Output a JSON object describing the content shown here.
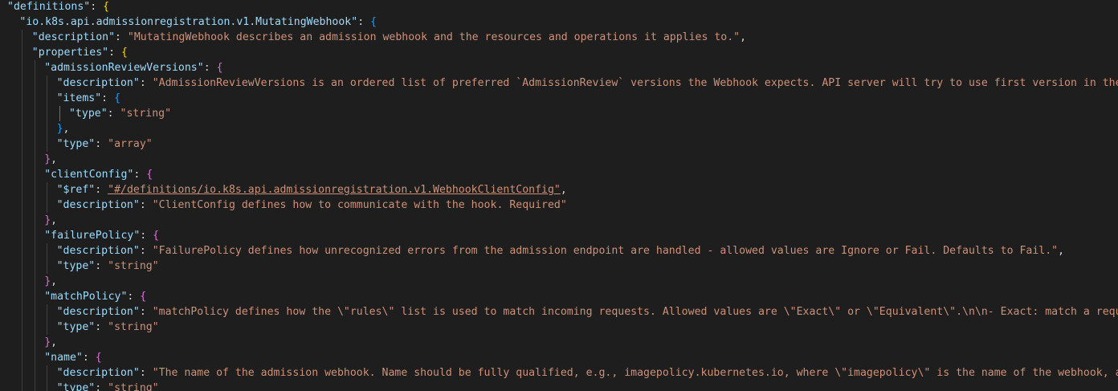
{
  "editor": {
    "lines": [
      {
        "indent": 0,
        "key": "\"definitions\"",
        "value": "",
        "open": "{",
        "bracket": "b1"
      },
      {
        "indent": 1,
        "key": "\"io.k8s.api.admissionregistration.v1.MutatingWebhook\"",
        "value": "",
        "open": "{",
        "bracket": "b3"
      },
      {
        "indent": 2,
        "key": "\"description\"",
        "value": "\"MutatingWebhook describes an admission webhook and the resources and operations it applies to.\"",
        "tail": ","
      },
      {
        "indent": 2,
        "key": "\"properties\"",
        "value": "",
        "open": "{",
        "bracket": "b1"
      },
      {
        "indent": 3,
        "key": "\"admissionReviewVersions\"",
        "value": "",
        "open": "{",
        "bracket": "b2"
      },
      {
        "indent": 4,
        "key": "\"description\"",
        "value": "\"AdmissionReviewVersions is an ordered list of preferred `AdmissionReview` versions the Webhook expects. API server will try to use first version in the list"
      },
      {
        "indent": 4,
        "key": "\"items\"",
        "value": "",
        "open": "{",
        "bracket": "b3"
      },
      {
        "indent": 5,
        "key": "\"type\"",
        "value": "\"string\""
      },
      {
        "indent": 4,
        "close": "}",
        "bracket": "b3",
        "tail": ","
      },
      {
        "indent": 4,
        "key": "\"type\"",
        "value": "\"array\""
      },
      {
        "indent": 3,
        "close": "}",
        "bracket": "b2",
        "tail": ","
      },
      {
        "indent": 3,
        "key": "\"clientConfig\"",
        "value": "",
        "open": "{",
        "bracket": "b2"
      },
      {
        "indent": 4,
        "key": "\"$ref\"",
        "value": "\"#/definitions/io.k8s.api.admissionregistration.v1.WebhookClientConfig\"",
        "tail": ",",
        "link": true
      },
      {
        "indent": 4,
        "key": "\"description\"",
        "value": "\"ClientConfig defines how to communicate with the hook. Required\""
      },
      {
        "indent": 3,
        "close": "}",
        "bracket": "b2",
        "tail": ","
      },
      {
        "indent": 3,
        "key": "\"failurePolicy\"",
        "value": "",
        "open": "{",
        "bracket": "b2"
      },
      {
        "indent": 4,
        "key": "\"description\"",
        "value": "\"FailurePolicy defines how unrecognized errors from the admission endpoint are handled - allowed values are Ignore or Fail. Defaults to Fail.\"",
        "tail": ","
      },
      {
        "indent": 4,
        "key": "\"type\"",
        "value": "\"string\""
      },
      {
        "indent": 3,
        "close": "}",
        "bracket": "b2",
        "tail": ","
      },
      {
        "indent": 3,
        "key": "\"matchPolicy\"",
        "value": "",
        "open": "{",
        "bracket": "b2"
      },
      {
        "indent": 4,
        "key": "\"description\"",
        "value": "\"matchPolicy defines how the \\\"rules\\\" list is used to match incoming requests. Allowed values are \\\"Exact\\\" or \\\"Equivalent\\\".\\n\\n- Exact: match a request c"
      },
      {
        "indent": 4,
        "key": "\"type\"",
        "value": "\"string\""
      },
      {
        "indent": 3,
        "close": "}",
        "bracket": "b2",
        "tail": ","
      },
      {
        "indent": 3,
        "key": "\"name\"",
        "value": "",
        "open": "{",
        "bracket": "b2"
      },
      {
        "indent": 4,
        "key": "\"description\"",
        "value": "\"The name of the admission webhook. Name should be fully qualified, e.g., imagepolicy.kubernetes.io, where \\\"imagepolicy\\\" is the name of the webhook, and ku"
      },
      {
        "indent": 4,
        "key": "\"type\"",
        "value": "\"string\""
      }
    ]
  }
}
